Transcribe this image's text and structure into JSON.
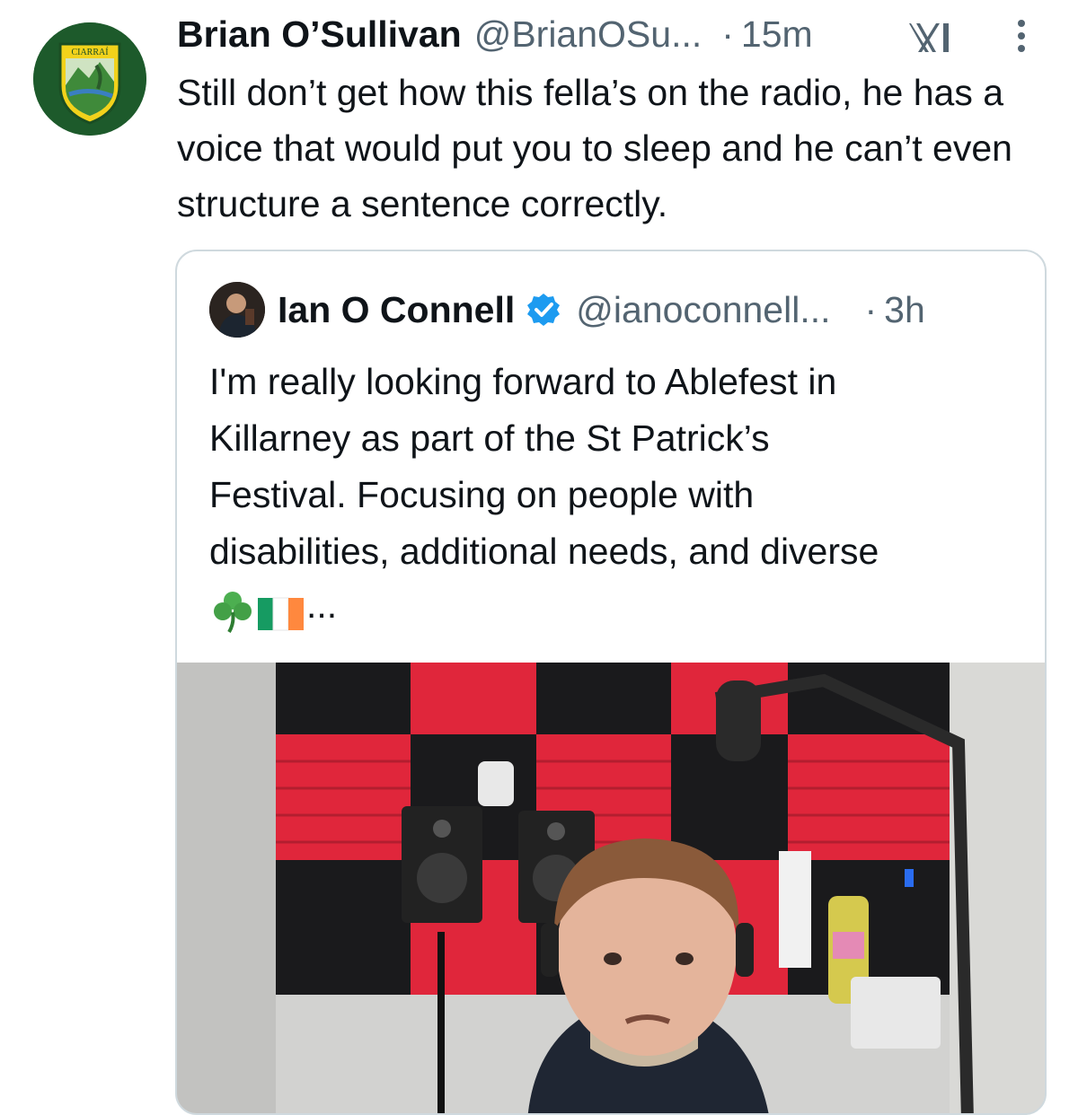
{
  "tweet": {
    "author_name": "Brian O’Sullivan",
    "handle": "@BrianOSu...",
    "separator": "·",
    "time": "15m",
    "avatar_text": "CIARRAÍ",
    "text": "Still don’t get how this fella’s on the radio, he has a voice that would put you to sleep and he can’t even structure a sentence correctly."
  },
  "quoted": {
    "author_name": "Ian O Connell",
    "handle": "@ianoconnell...",
    "separator": "·",
    "time": "3h",
    "verified": true,
    "lines": [
      "I'm really looking forward to Ablefest in",
      "Killarney as part of the St Patrick’s",
      "Festival. Focusing on people with",
      "disabilities, additional needs, and diverse"
    ],
    "ellipsis": "...",
    "emojis": [
      "shamrock",
      "ireland-flag"
    ]
  },
  "colors": {
    "text": "#0f1419",
    "secondary": "#536471",
    "border": "#cfd9de",
    "verified_blue": "#1d9bf0",
    "kerry_green": "#1d5a2b",
    "kerry_gold": "#f2d21b",
    "foam_red": "#e0263b"
  }
}
